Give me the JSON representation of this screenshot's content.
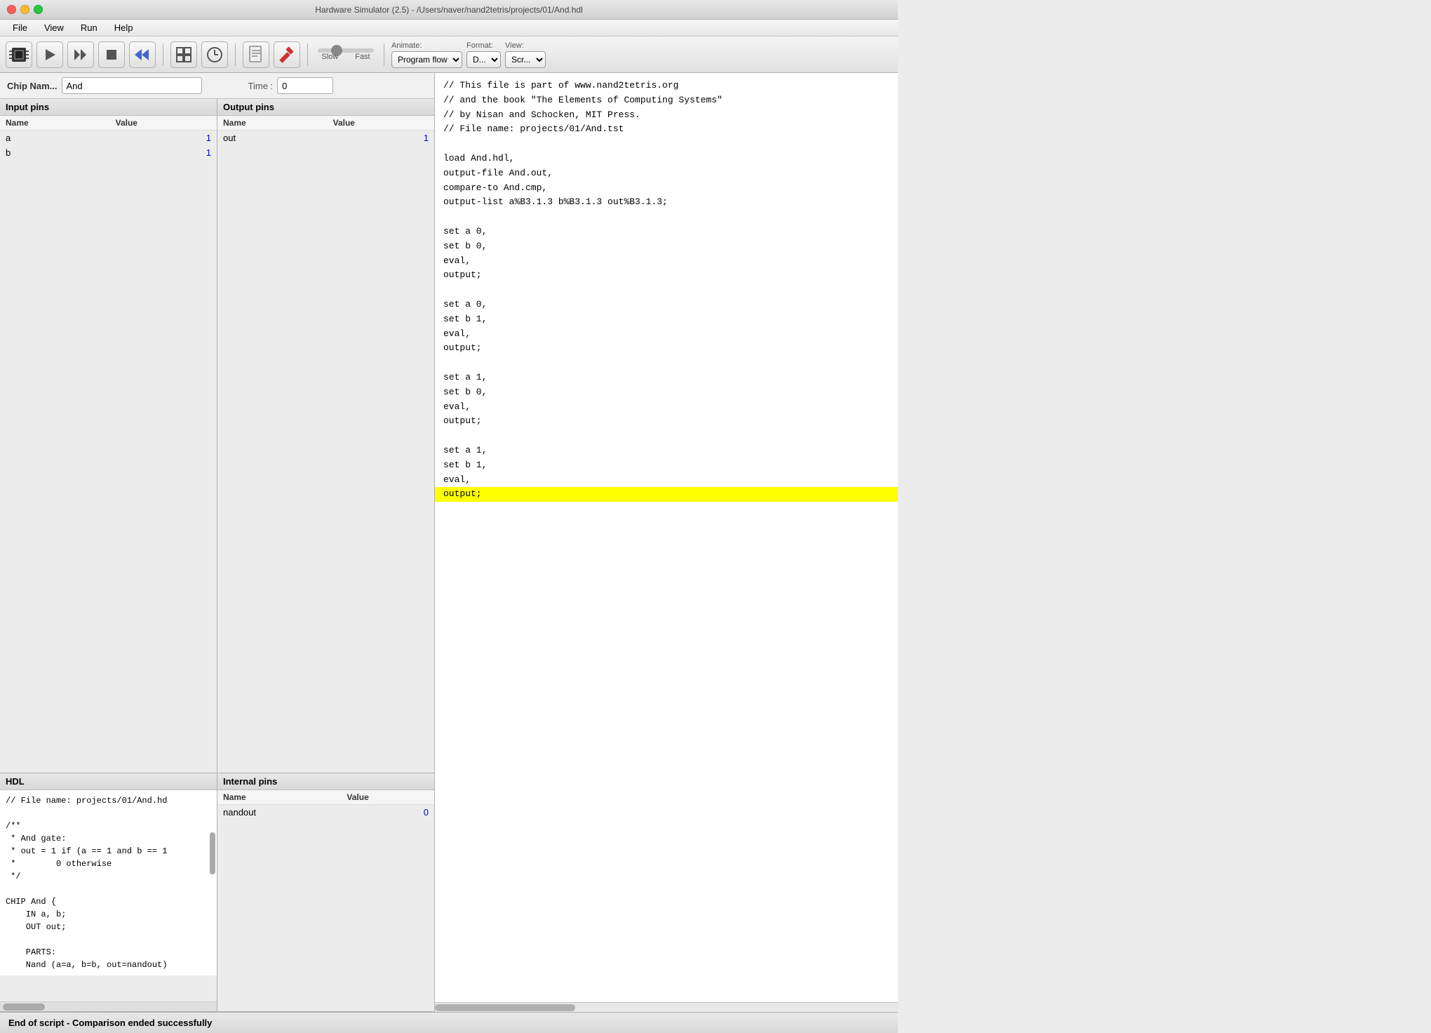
{
  "window": {
    "title": "Hardware Simulator (2.5) - /Users/naver/nand2tetris/projects/01/And.hdl",
    "close_btn": "●",
    "min_btn": "●",
    "max_btn": "●"
  },
  "menubar": {
    "items": [
      "File",
      "View",
      "Run",
      "Help"
    ]
  },
  "toolbar": {
    "animate_label": "Animate:",
    "animate_value": "Program flow",
    "format_label": "Format:",
    "format_value": "D...",
    "view_label": "View:",
    "view_value": "Scr...",
    "speed_slow": "Slow",
    "speed_fast": "Fast"
  },
  "chip": {
    "name_label": "Chip Nam...",
    "name_value": "And",
    "time_label": "Time :",
    "time_value": "0"
  },
  "input_pins": {
    "header": "Input pins",
    "col_name": "Name",
    "col_value": "Value",
    "rows": [
      {
        "name": "a",
        "value": "1"
      },
      {
        "name": "b",
        "value": "1"
      }
    ]
  },
  "output_pins": {
    "header": "Output pins",
    "col_name": "Name",
    "col_value": "Value",
    "rows": [
      {
        "name": "out",
        "value": "1"
      }
    ]
  },
  "hdl": {
    "header": "HDL",
    "content": "// File name: projects/01/And.hd\n\n/**\n * And gate:\n * out = 1 if (a == 1 and b == 1\n *        0 otherwise\n */\n\nCHIP And {\n    IN a, b;\n    OUT out;\n\n    PARTS:\n    Nand (a=a, b=b, out=nandout)"
  },
  "internal_pins": {
    "header": "Internal pins",
    "col_name": "Name",
    "col_value": "Value",
    "rows": [
      {
        "name": "nandout",
        "value": "0"
      }
    ]
  },
  "code": {
    "content_lines": [
      "// This file is part of www.nand2tetris.org",
      "// and the book \"The Elements of Computing Systems\"",
      "// by Nisan and Schocken, MIT Press.",
      "// File name: projects/01/And.tst",
      "",
      "load And.hdl,",
      "output-file And.out,",
      "compare-to And.cmp,",
      "output-list a%B3.1.3 b%B3.1.3 out%B3.1.3;",
      "",
      "set a 0,",
      "set b 0,",
      "eval,",
      "output;",
      "",
      "set a 0,",
      "set b 1,",
      "eval,",
      "output;",
      "",
      "set a 1,",
      "set b 0,",
      "eval,",
      "output;",
      "",
      "set a 1,",
      "set b 1,",
      "eval,",
      "output;"
    ],
    "highlighted_line_index": 28
  },
  "statusbar": {
    "message": "End of script - Comparison ended successfully"
  }
}
